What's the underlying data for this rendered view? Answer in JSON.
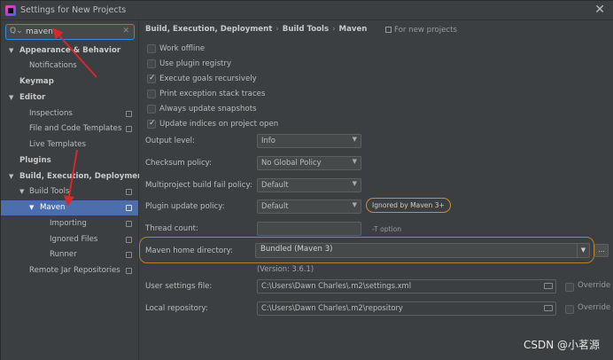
{
  "window": {
    "title": "Settings for New Projects",
    "close_glyph": "✕"
  },
  "search": {
    "value": "maven",
    "icon": "search-icon",
    "clear_glyph": "✕"
  },
  "sidebar": {
    "items": [
      {
        "label": "Appearance & Behavior",
        "bold": true,
        "expanded": true
      },
      {
        "label": "Notifications"
      },
      {
        "label": "Keymap",
        "bold": true
      },
      {
        "label": "Editor",
        "bold": true,
        "expanded": true
      },
      {
        "label": "Inspections"
      },
      {
        "label": "File and Code Templates"
      },
      {
        "label": "Live Templates"
      },
      {
        "label": "Plugins",
        "bold": true
      },
      {
        "label": "Build, Execution, Deployment",
        "bold": true,
        "expanded": true
      },
      {
        "label": "Build Tools",
        "expanded": true
      },
      {
        "label": "Maven",
        "expanded": true,
        "selected": true
      },
      {
        "label": "Importing"
      },
      {
        "label": "Ignored Files"
      },
      {
        "label": "Runner"
      },
      {
        "label": "Remote Jar Repositories"
      }
    ]
  },
  "breadcrumb": {
    "part1": "Build, Execution, Deployment",
    "part2": "Build Tools",
    "part3": "Maven",
    "separator": "›"
  },
  "scope_label": "For new projects",
  "options": {
    "work_offline": {
      "label": "Work offline",
      "checked": false
    },
    "use_plugin_registry": {
      "label": "Use plugin registry",
      "checked": false
    },
    "execute_goals": {
      "label": "Execute goals recursively",
      "checked": true
    },
    "print_exception": {
      "label": "Print exception stack traces",
      "checked": false
    },
    "always_update": {
      "label": "Always update snapshots",
      "checked": false
    },
    "update_indices": {
      "label": "Update indices on project open",
      "checked": true
    }
  },
  "fields": {
    "output_level": {
      "label": "Output level:",
      "value": "Info"
    },
    "checksum_policy": {
      "label": "Checksum policy:",
      "value": "No Global Policy"
    },
    "multiproject_policy": {
      "label": "Multiproject build fail policy:",
      "value": "Default"
    },
    "plugin_update_policy": {
      "label": "Plugin update policy:",
      "value": "Default",
      "badge": "Ignored by Maven 3+"
    },
    "thread_count": {
      "label": "Thread count:",
      "value": "",
      "note": "-T option"
    },
    "maven_home": {
      "label": "Maven home directory:",
      "value": "Bundled (Maven 3)",
      "version": "(Version: 3.6.1)",
      "browse": "..."
    },
    "user_settings": {
      "label": "User settings file:",
      "value": "C:\\Users\\Dawn Charles\\.m2\\settings.xml",
      "override": "Override"
    },
    "local_repo": {
      "label": "Local repository:",
      "value": "C:\\Users\\Dawn Charles\\.m2\\repository",
      "override": "Override"
    }
  },
  "watermark": "CSDN @小茗源",
  "colors": {
    "background": "#3c3f41",
    "selection": "#4b6eaf",
    "focus_border": "#3d8ad9",
    "annotation_red": "#d8282a",
    "highlight_orange": "#d48c29"
  }
}
